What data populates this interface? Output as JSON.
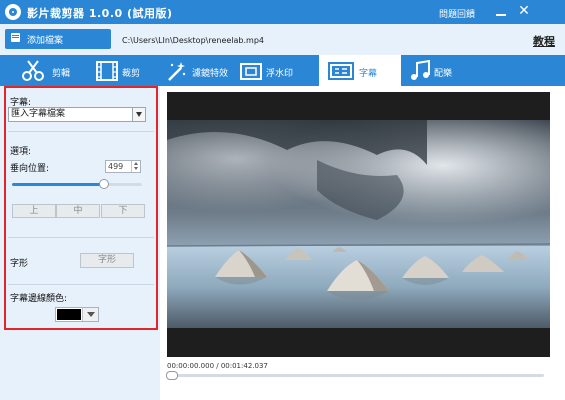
{
  "app": {
    "title": "影片裁剪器 1.0.0 (試用版)",
    "feedback_label": "問題回饋",
    "close_glyph": "✕"
  },
  "toolbar": {
    "add_file_label": "添加檔案",
    "file_path": "C:\\Users\\LIn\\Desktop\\reneelab.mp4",
    "tutorial_label": "教程"
  },
  "tabs": [
    {
      "label": "剪輯",
      "icon": "scissors-icon",
      "active": false
    },
    {
      "label": "裁剪",
      "icon": "film-crop-icon",
      "active": false
    },
    {
      "label": "濾鏡特效",
      "icon": "magic-wand-icon",
      "active": false
    },
    {
      "label": "浮水印",
      "icon": "watermark-icon",
      "active": false
    },
    {
      "label": "字幕",
      "icon": "subtitle-icon",
      "active": true
    },
    {
      "label": "配樂",
      "icon": "music-note-icon",
      "active": false
    }
  ],
  "panel": {
    "subtitle_heading": "字幕:",
    "subtitle_select_value": "匯入字幕檔案",
    "options_heading": "選項:",
    "vertical_position_label": "垂向位置:",
    "vertical_position_value": "499",
    "vertical_position_level": 0.71,
    "align_buttons": [
      "上",
      "中",
      "下"
    ],
    "font_label": "字形",
    "font_button_label": "字形",
    "outline_color_label": "字幕邊線顏色:",
    "outline_color": "#000000"
  },
  "player": {
    "time_readout": "00:00:00.000 / 00:01:42.037",
    "progress": 0.0
  },
  "colors": {
    "accent": "#2b87d6",
    "panel_bg": "#e7f1fb",
    "highlight_border": "#e0262b"
  }
}
